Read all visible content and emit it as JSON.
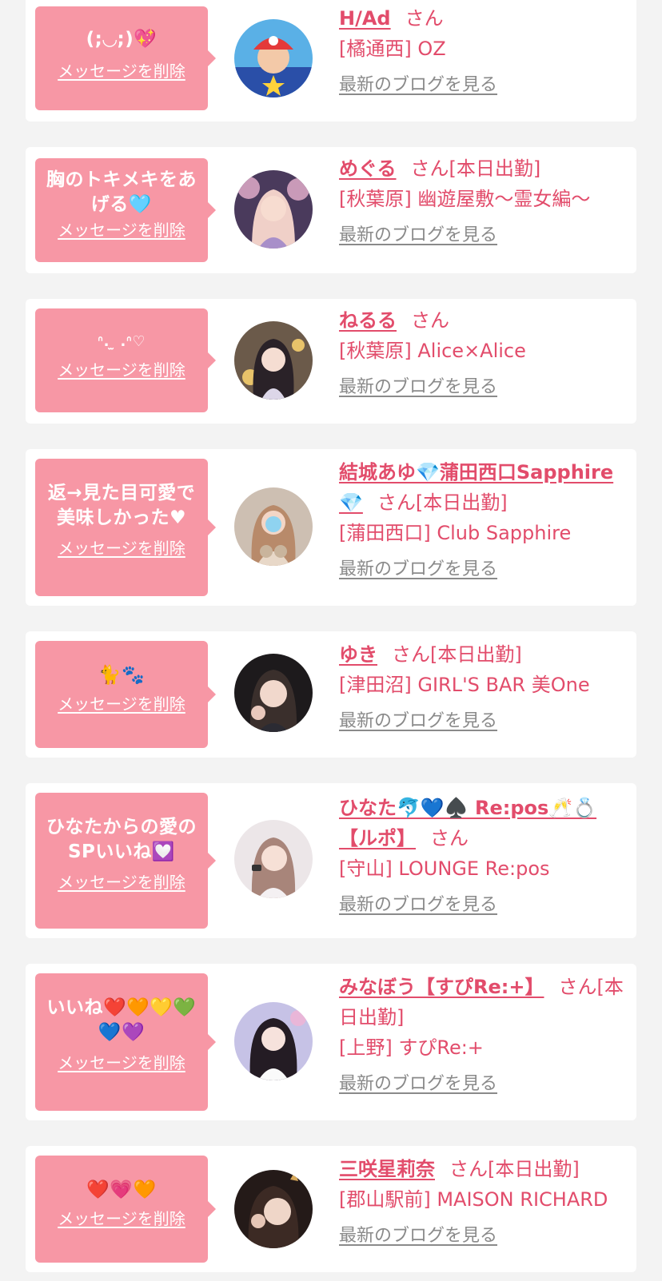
{
  "common": {
    "delete_label": "メッセージを削除",
    "blog_label": "最新のブログを見る",
    "san": "さん"
  },
  "colors": {
    "background": "#f3f3f3",
    "card": "#ffffff",
    "bubble": "#f797a5",
    "accent": "#e24c6b",
    "link_gray": "#8a8a8a"
  },
  "items": [
    {
      "message": "(;◡;)💖",
      "name": "H/Ad",
      "status": "",
      "shop": "[橘通西] OZ"
    },
    {
      "message": "胸のトキメキをあげる🩵",
      "name": "めぐる",
      "status": "[本日出勤]",
      "shop": "[秋葉原] 幽遊屋敷〜霊女編〜"
    },
    {
      "message": "ᐢ. ̫ .ᐢ♡",
      "name": "ねるる",
      "status": "",
      "shop": "[秋葉原] Alice×Alice"
    },
    {
      "message": "返→見た目可愛で美味しかった♥",
      "name": "結城あゆ💎蒲田西口Sapphire💎",
      "status": "[本日出勤]",
      "shop": "[蒲田西口] Club Sapphire"
    },
    {
      "message": "🐈🐾",
      "name": "ゆき",
      "status": "[本日出勤]",
      "shop": "[津田沼] GIRL'S BAR 美One"
    },
    {
      "message": "ひなたからの愛のSPいいね💟",
      "name": "ひなた🐬💙♠️ Re:pos🥂💍【ルポ】",
      "status": "",
      "shop": "[守山] LOUNGE Re:pos"
    },
    {
      "message": "いいね❤️🧡💛💚💙💜",
      "name": "みなぼう【すぴRe:+】",
      "status": "[本日出勤]",
      "shop": "[上野] すぴRe:+"
    },
    {
      "message": "❤️💗🧡",
      "name": "三咲星莉奈",
      "status": "[本日出勤]",
      "shop": "[郡山駅前] MAISON RICHARD"
    }
  ]
}
